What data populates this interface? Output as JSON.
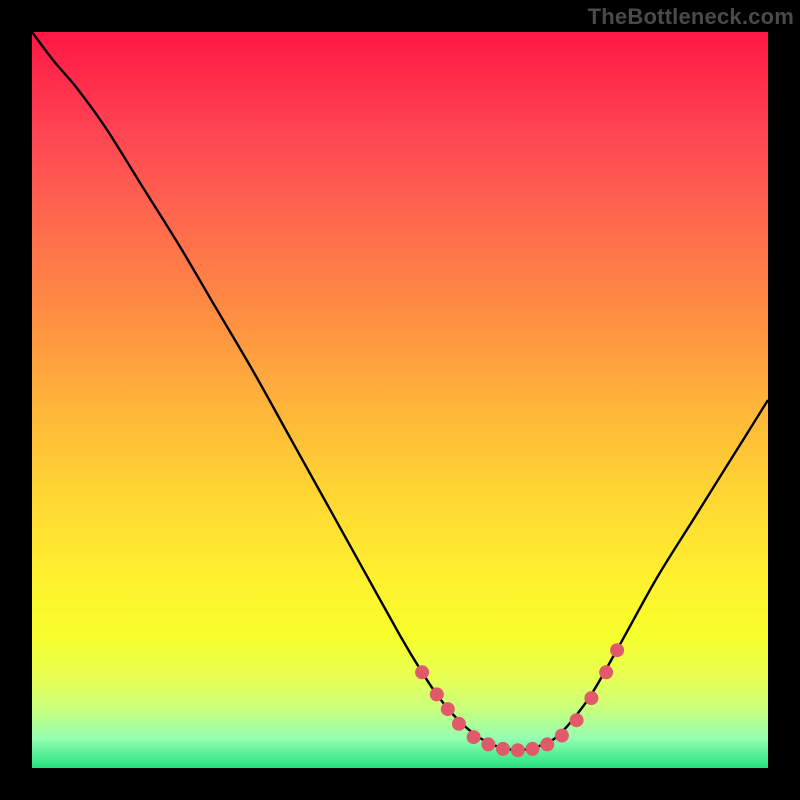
{
  "watermark": "TheBottleneck.com",
  "colors": {
    "background": "#000000",
    "curve": "#000000",
    "dots": "#e05a6a"
  },
  "chart_data": {
    "type": "line",
    "title": "",
    "xlabel": "",
    "ylabel": "",
    "xlim": [
      0,
      100
    ],
    "ylim": [
      0,
      100
    ],
    "grid": false,
    "series": [
      {
        "name": "bottleneck-curve",
        "x": [
          0,
          3,
          6,
          10,
          15,
          20,
          25,
          30,
          35,
          40,
          45,
          50,
          53,
          55,
          57,
          59,
          61,
          63,
          65,
          67,
          69,
          71,
          73,
          76,
          80,
          85,
          90,
          95,
          100
        ],
        "y": [
          100,
          96,
          92.5,
          87,
          79,
          71,
          62.5,
          54,
          45,
          36,
          27,
          18,
          13,
          10,
          7.5,
          5.5,
          4,
          3,
          2.5,
          2.5,
          3,
          4,
          6,
          10,
          17,
          26,
          34,
          42,
          50
        ]
      }
    ],
    "markers": [
      {
        "x": 53,
        "y": 13
      },
      {
        "x": 55,
        "y": 10
      },
      {
        "x": 56.5,
        "y": 8
      },
      {
        "x": 58,
        "y": 6
      },
      {
        "x": 60,
        "y": 4.2
      },
      {
        "x": 62,
        "y": 3.2
      },
      {
        "x": 64,
        "y": 2.6
      },
      {
        "x": 66,
        "y": 2.4
      },
      {
        "x": 68,
        "y": 2.6
      },
      {
        "x": 70,
        "y": 3.2
      },
      {
        "x": 72,
        "y": 4.4
      },
      {
        "x": 74,
        "y": 6.5
      },
      {
        "x": 76,
        "y": 9.5
      },
      {
        "x": 78,
        "y": 13
      },
      {
        "x": 79.5,
        "y": 16
      }
    ]
  }
}
